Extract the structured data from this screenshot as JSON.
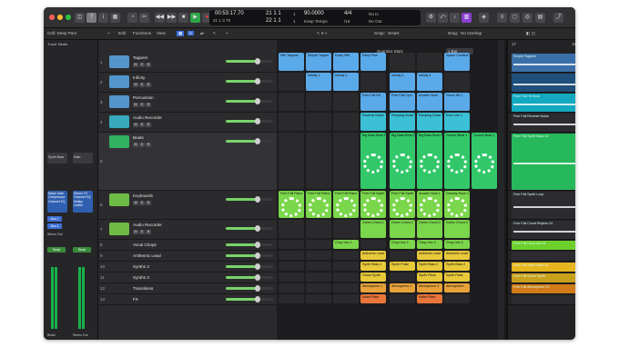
{
  "transport": {
    "position_bars": "00:53:17.70",
    "position_beats": "21 1 3 70",
    "bar_top": "21 1 1",
    "bar_top_tick": "1",
    "bar_bottom": "22 1 1",
    "bar_bottom_tick": "1",
    "tempo": "90.0000",
    "tempo_mode": "Keep Tempo",
    "time_sig": "4/4",
    "division": "/16",
    "in": "No In",
    "out": "No Out"
  },
  "control_bar": {
    "cell_label": "Cell: Deep Pam",
    "track_label": "Track: Beats",
    "edit": "Edit",
    "functions": "Functions",
    "view": "View",
    "snap_label": "Snap:",
    "snap_value": "Smart",
    "drag_label": "Drag:",
    "drag_value": "No Overlap",
    "quantize_label": "Quantize Start:",
    "quantize_value": "1 Bar"
  },
  "ruler": {
    "bar17": "17",
    "bar18": "18"
  },
  "inspector": {
    "plugin_top": "Synth Bass",
    "plugin_top2": "Main",
    "eq_a": "Noise Gate",
    "eq_b": "Compressor",
    "eq_c": "Channel EQ",
    "eq_d": "Stereo FX",
    "eq_e": "Channel EQ",
    "eq_f": "Multipr",
    "eq_g": "Limiter",
    "bus1": "Bus 1",
    "bus2": "Bus 2",
    "stereo_out": "Stereo Out",
    "read": "Read",
    "strip_a": "Beats",
    "strip_b": "Stereo Out",
    "fx_a": "Read",
    "fx_b": "Bounce"
  },
  "tracks": [
    {
      "num": "1",
      "name": "Tappers",
      "color": "#5aa9e8"
    },
    {
      "num": "2",
      "name": "Infinity",
      "color": "#5aa9e8"
    },
    {
      "num": "3",
      "name": "Percussion",
      "color": "#5aa9e8"
    },
    {
      "num": "4",
      "name": "Audio Recorder",
      "color": "#3bc0d6"
    },
    {
      "num": "5",
      "name": "Beats",
      "color": "#32c86a"
    },
    {
      "num": "6",
      "name": "Keyboards",
      "color": "#7ad64a"
    },
    {
      "num": "7",
      "name": "Audio Recorder",
      "color": "#7ad64a"
    },
    {
      "num": "8",
      "name": "Vocal Chops",
      "color": "#7ad64a"
    },
    {
      "num": "9",
      "name": "Anthemic Lead",
      "color": "#e8c93a"
    },
    {
      "num": "10",
      "name": "Synths 2",
      "color": "#e8c93a"
    },
    {
      "num": "11",
      "name": "Synths 3",
      "color": "#e8c93a"
    },
    {
      "num": "12",
      "name": "Transitions",
      "color": "#e8a23a"
    },
    {
      "num": "13",
      "name": "FX",
      "color": "#e8763a"
    }
  ],
  "cells": {
    "r1": [
      "Hihi Tappers",
      "Simple Tapper",
      "Dowy Hihi",
      "Deep Pam",
      "",
      "",
      "Space Chatters"
    ],
    "r2": [
      "",
      "Infinity 1",
      "Infinity 2",
      "",
      "Infinity 3",
      "Infinity 4",
      ""
    ],
    "r3": [
      "",
      "",
      "",
      "Free Fall Hit",
      "Free Fall Cym",
      "Arcade Hook",
      "Groov Hit 1"
    ],
    "r4": [
      "",
      "",
      "",
      "Reverse Noise",
      "Pumping Noise",
      "Pumping Noise",
      "Echo Vox 1"
    ],
    "r5": [
      "",
      "",
      "",
      "Big Bass Beat 1",
      "Big Bass Beat 2",
      "Big Bass Beat 3",
      "Groove Beat 1",
      "Groove Beat 1"
    ],
    "r6": [
      "Free Fall Piano",
      "Free Fall Piano",
      "Free Fall Piano",
      "Free Fall Synth",
      "Free Fall Synth",
      "Arcade Hook 1",
      "Dreamy Hook 1"
    ],
    "r7": [
      "",
      "",
      "",
      "Green Chord 1",
      "Green Chord 2",
      "Green Chord 3",
      "Green Chord 4"
    ],
    "r8": [
      "",
      "",
      "Chop Vox 1",
      "",
      "Chop Vox 2",
      "Chop Vox 3",
      "Chop Vox 4"
    ],
    "r9": [
      "",
      "",
      "",
      "Anthemic Lead",
      "",
      "Anthemic Lead",
      "Anthemic Lead"
    ],
    "r10": [
      "",
      "",
      "",
      "Synth Bass 1",
      "Synth Pulse",
      "Synth Bass 2",
      "Synth Bass 2"
    ],
    "r11": [
      "",
      "",
      "",
      "Ghost Synth",
      "",
      "Synth Pluck",
      "Synth Pads"
    ],
    "r12": [
      "",
      "",
      "",
      "Atmosphere 1",
      "Atmosphere 2",
      "Atmosphere 3",
      "Atmosphere"
    ],
    "r13": [
      "",
      "",
      "",
      "Noise Riser",
      "",
      "Noise Riser",
      ""
    ]
  },
  "regions": [
    {
      "label": "Simple Tappers",
      "color": "#3b6fa8"
    },
    {
      "label": "",
      "color": "#1f4f7a"
    },
    {
      "label": "Free Fall Hit Hook",
      "color": "#13a9c0"
    },
    {
      "label": "Free Fall Reverse Noise",
      "color": "#2b2b30"
    },
    {
      "label": "Free Fall Synth Bass Vo",
      "color": "#28b85c"
    },
    {
      "label": "Free Fall Synth Loop",
      "color": "#2b2b30"
    },
    {
      "label": "Free Fall Chord Rhythm 01",
      "color": "#2b2b30"
    },
    {
      "label": "Free Fall Chop Vox 01",
      "color": "#6ed02c"
    },
    {
      "label": "",
      "color": "#2b2b30"
    },
    {
      "label": "Free Fall Synth Bass 03",
      "color": "#e7b51f"
    },
    {
      "label": "Free Fall Ghost Synth",
      "color": "#c9a01c"
    },
    {
      "label": "Free Fall Atmosphere 01",
      "color": "#d07b17"
    },
    {
      "label": "",
      "color": "#2b2b30"
    }
  ],
  "colors": {
    "bg": "#1b1b1d",
    "accent_blue": "#5aa9e8",
    "accent_green": "#32c86a",
    "accent_yellow": "#e8c93a"
  }
}
